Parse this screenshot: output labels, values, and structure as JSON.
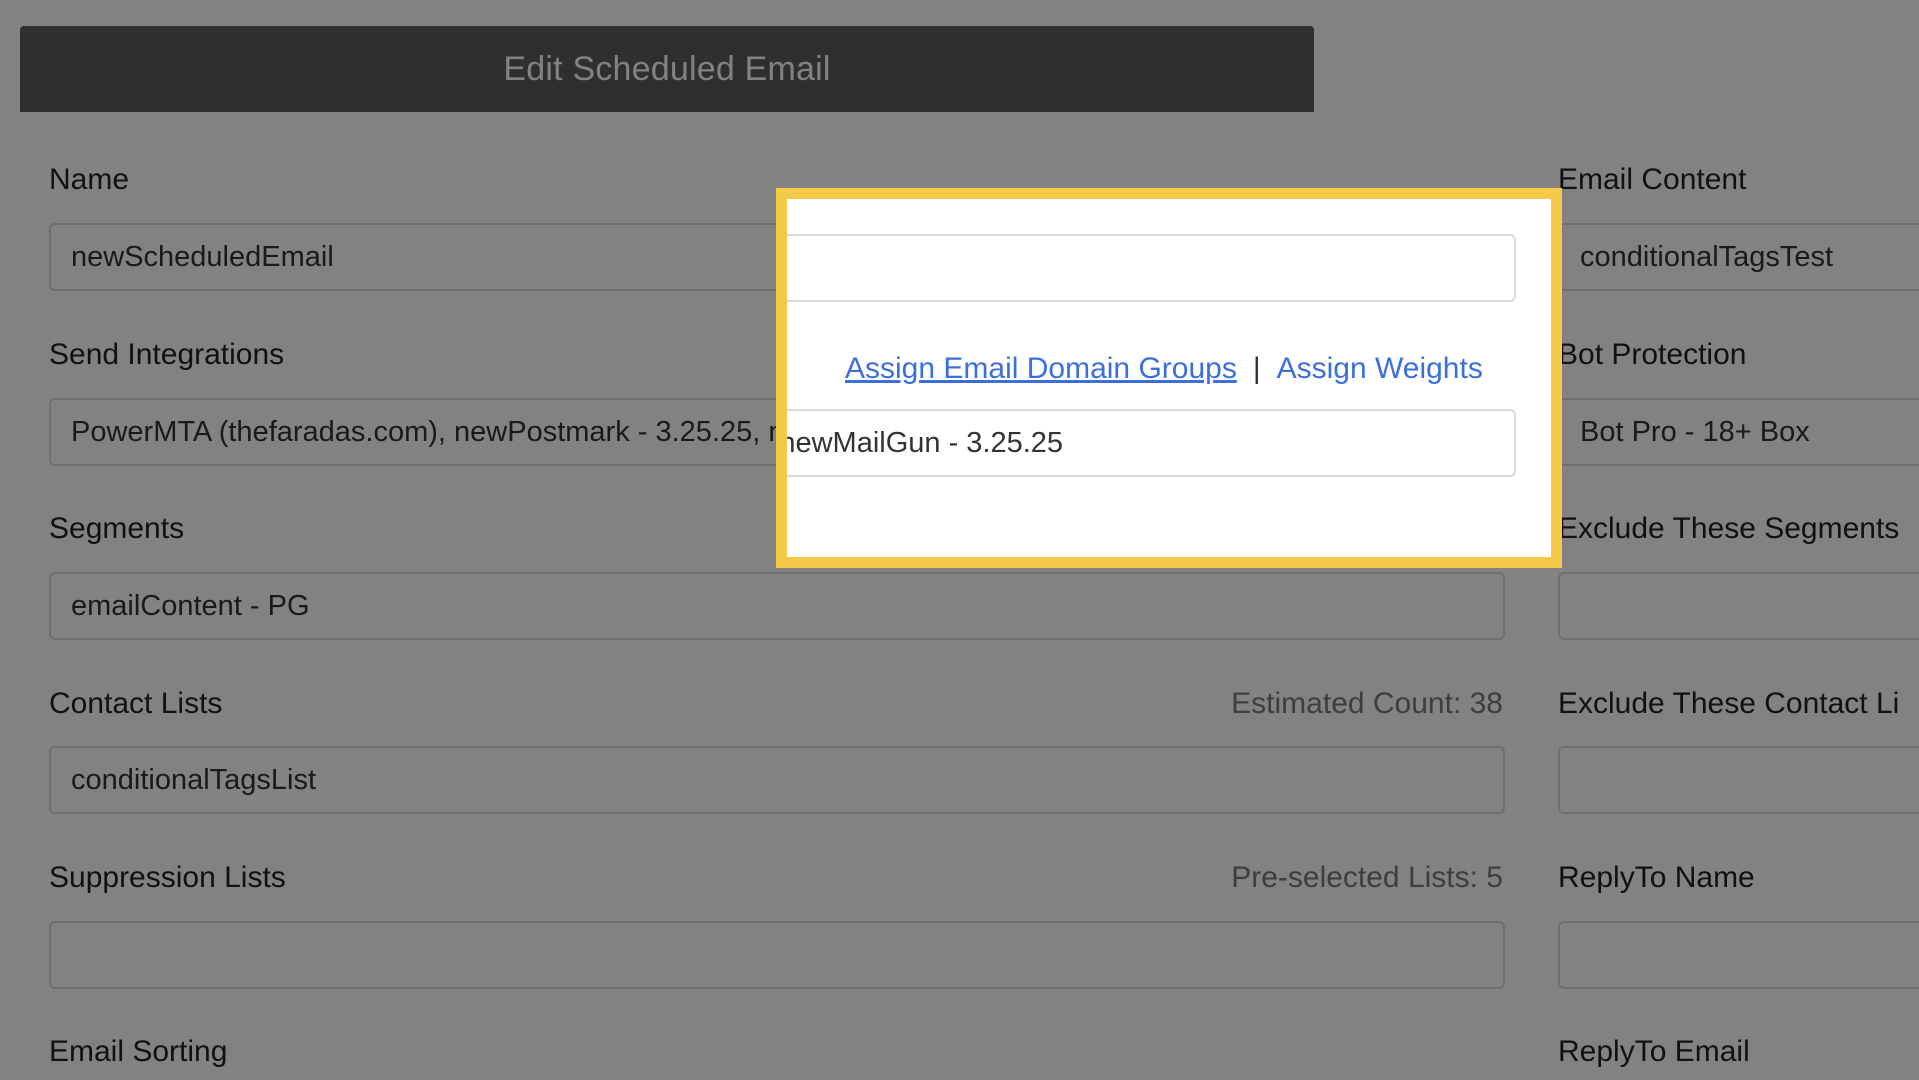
{
  "modal": {
    "title": "Edit Scheduled Email"
  },
  "form": {
    "name": {
      "label": "Name",
      "value": "newScheduledEmail"
    },
    "send_integrations": {
      "label": "Send Integrations",
      "value": "PowerMTA (thefaradas.com), newPostmark - 3.25.25, newMailGun - 3.25.25",
      "assign_domain_groups_link": "Assign Email Domain Groups",
      "separator": "|",
      "assign_weights_link": "Assign Weights"
    },
    "segments": {
      "label": "Segments",
      "value": "emailContent - PG"
    },
    "contact_lists": {
      "label": "Contact Lists",
      "value": "conditionalTagsList",
      "meta": "Estimated Count: 38"
    },
    "suppression_lists": {
      "label": "Suppression Lists",
      "value": "",
      "meta": "Pre-selected Lists: 5"
    },
    "email_sorting": {
      "label": "Email Sorting"
    },
    "email_content": {
      "label": "Email Content",
      "value": "conditionalTagsTest"
    },
    "bot_protection": {
      "label": "Bot Protection",
      "value": "Bot Pro - 18+ Box"
    },
    "exclude_segments": {
      "label": "Exclude These Segments",
      "value": ""
    },
    "exclude_contact_lists": {
      "label": "Exclude These Contact Li",
      "value": ""
    },
    "replyto_name": {
      "label": "ReplyTo Name",
      "value": ""
    },
    "replyto_email": {
      "label": "ReplyTo Email"
    }
  },
  "theme": {
    "header_bg": "#5c5c5c",
    "link_color": "#3b6fdc",
    "highlight_border": "#f7c948"
  }
}
